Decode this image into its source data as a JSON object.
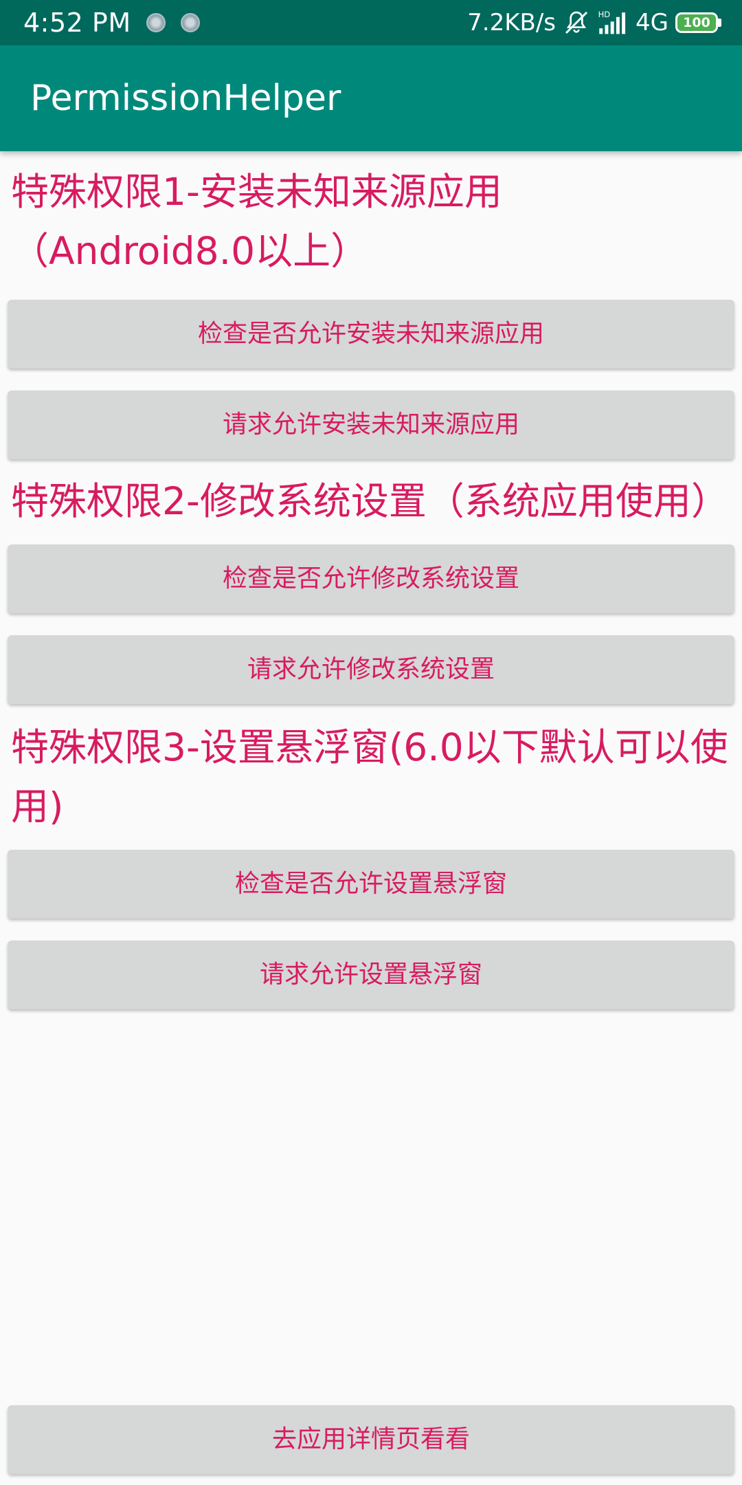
{
  "status_bar": {
    "time": "4:52 PM",
    "network_speed": "7.2KB/s",
    "network_type": "4G",
    "battery_level": "100",
    "battery_color": "#4caf50",
    "icons": [
      "notification-icon",
      "notification-icon",
      "mute-icon",
      "hd-signal-icon",
      "battery-icon"
    ]
  },
  "app_bar": {
    "title": "PermissionHelper",
    "color": "#00897b"
  },
  "sections": [
    {
      "title": "特殊权限1-安装未知来源应用（Android8.0以上）",
      "buttons": [
        "检查是否允许安装未知来源应用",
        "请求允许安装未知来源应用"
      ]
    },
    {
      "title": "特殊权限2-修改系统设置（系统应用使用）",
      "buttons": [
        "检查是否允许修改系统设置",
        "请求允许修改系统设置"
      ]
    },
    {
      "title": "特殊权限3-设置悬浮窗(6.0以下默认可以使用)",
      "buttons": [
        "检查是否允许设置悬浮窗",
        "请求允许设置悬浮窗"
      ]
    }
  ],
  "bottom_button": "去应用详情页看看",
  "accent_color": "#d81b60"
}
